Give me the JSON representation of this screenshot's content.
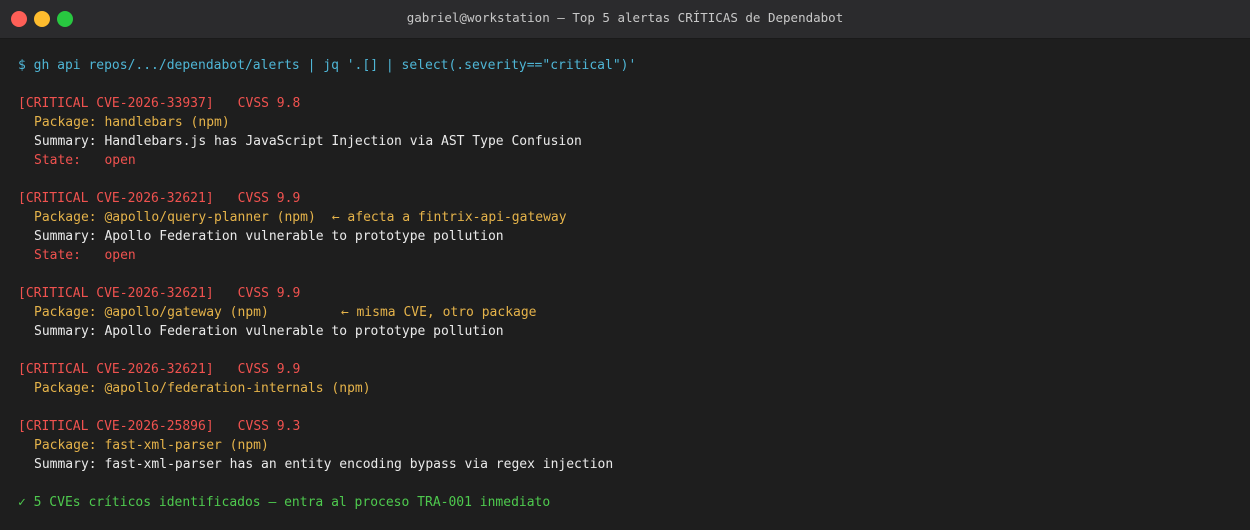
{
  "window": {
    "title": "gabriel@workstation — Top 5 alertas CRÍTICAS de Dependabot"
  },
  "terminal": {
    "command": "$ gh api repos/.../dependabot/alerts | jq '.[] | select(.severity==\"critical\")'",
    "alerts": [
      {
        "header": "[CRITICAL CVE-2026-33937]",
        "cvss": "CVSS 9.8",
        "package_label": "Package: ",
        "package": "handlebars (npm)",
        "note": "",
        "summary_label": "Summary: ",
        "summary": "Handlebars.js has JavaScript Injection via AST Type Confusion",
        "state_label": "State:   ",
        "state": "open"
      },
      {
        "header": "[CRITICAL CVE-2026-32621]",
        "cvss": "CVSS 9.9",
        "package_label": "Package: ",
        "package": "@apollo/query-planner (npm)",
        "note": "← afecta a fintrix-api-gateway",
        "summary_label": "Summary: ",
        "summary": "Apollo Federation vulnerable to prototype pollution",
        "state_label": "State:   ",
        "state": "open"
      },
      {
        "header": "[CRITICAL CVE-2026-32621]",
        "cvss": "CVSS 9.9",
        "package_label": "Package: ",
        "package": "@apollo/gateway (npm)",
        "note": "← misma CVE, otro package",
        "summary_label": "Summary: ",
        "summary": "Apollo Federation vulnerable to prototype pollution"
      },
      {
        "header": "[CRITICAL CVE-2026-32621]",
        "cvss": "CVSS 9.9",
        "package_label": "Package: ",
        "package": "@apollo/federation-internals (npm)"
      },
      {
        "header": "[CRITICAL CVE-2026-25896]",
        "cvss": "CVSS 9.3",
        "package_label": "Package: ",
        "package": "fast-xml-parser (npm)",
        "summary_label": "Summary: ",
        "summary": "fast-xml-parser has an entity encoding bypass via regex injection"
      }
    ],
    "footer": "✓ 5 CVEs críticos identificados — entra al proceso TRA-001 inmediato"
  },
  "colors": {
    "background": "#1e1e1e",
    "command": "#4fb6d6",
    "critical": "#f0524f",
    "package": "#e5b34a",
    "success": "#4ec94e"
  }
}
